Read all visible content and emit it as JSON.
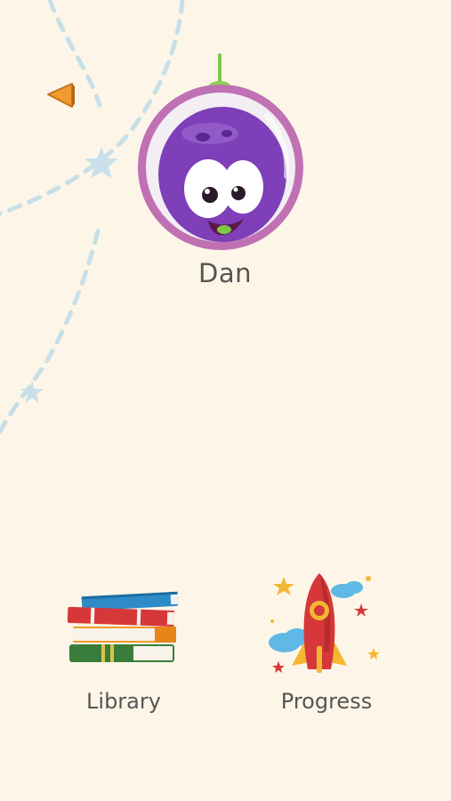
{
  "profile": {
    "name": "Dan",
    "avatar_icon": "purple-alien-avatar-icon"
  },
  "navigation": {
    "back_icon": "back-arrow-icon",
    "library_label": "Library",
    "library_icon": "books-stack-icon",
    "progress_label": "Progress",
    "progress_icon": "rocket-icon"
  },
  "theme": {
    "background": "#fdf6e8",
    "back_arrow_color": "#f29a2e",
    "avatar_ring": "#c071b4",
    "avatar_body": "#7e3fb8",
    "path_color": "#c7dfe6",
    "text_color": "#555555"
  }
}
